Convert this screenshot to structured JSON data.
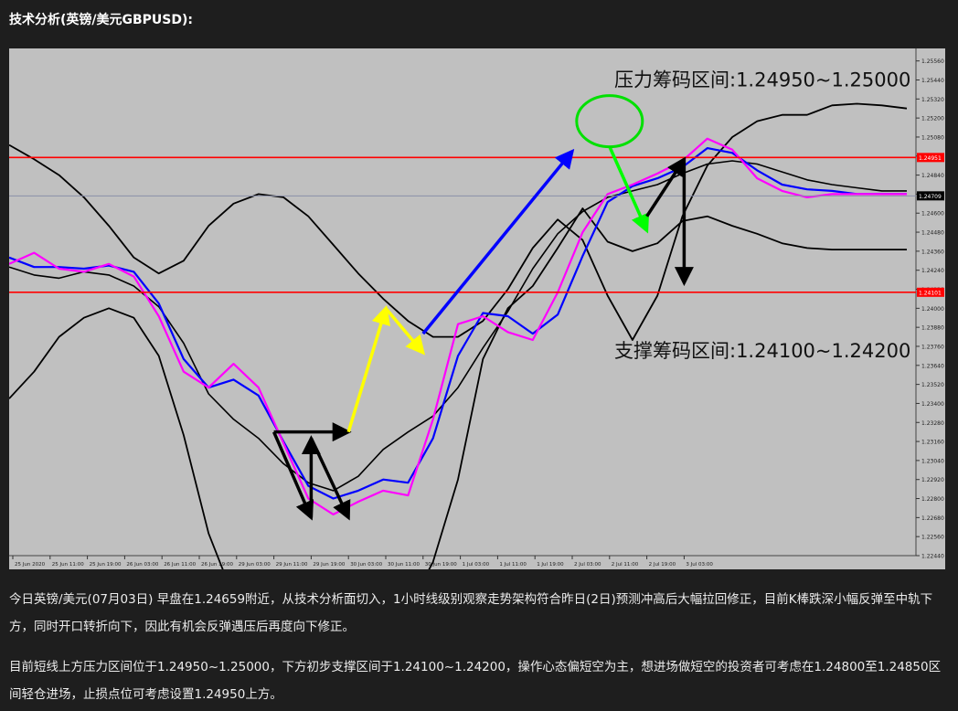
{
  "page": {
    "heading": "技术分析(英镑/美元GBPUSD):",
    "paragraphs": [
      "今日英镑/美元(07月03日) 早盘在1.24659附近，从技术分析面切入，1小时线级别观察走势架构符合昨日(2日)预测冲高后大幅拉回修正，目前K棒跌深小幅反弹至中轨下方，同时开口转折向下，因此有机会反弹遇压后再度向下修正。",
      "目前短线上方压力区间位于1.24950~1.25000，下方初步支撑区间于1.24100~1.24200，操作心态偏短空为主，想进场做短空的投资者可考虑在1.24800至1.24850区间轻仓进场，止损点位可考虑设置1.24950上方。"
    ]
  },
  "chart_data": {
    "type": "line",
    "title": "",
    "instrument": "GBPUSD",
    "timeframe": "H1",
    "x_tick_labels": [
      "25 Jun 2020",
      "25 Jun 11:00",
      "25 Jun 19:00",
      "26 Jun 03:00",
      "26 Jun 11:00",
      "26 Jun 19:00",
      "29 Jun 03:00",
      "29 Jun 11:00",
      "29 Jun 19:00",
      "30 Jun 03:00",
      "30 Jun 11:00",
      "30 Jun 19:00",
      "1 Jul 03:00",
      "1 Jul 11:00",
      "1 Jul 19:00",
      "2 Jul 03:00",
      "2 Jul 11:00",
      "2 Jul 19:00",
      "3 Jul 03:00"
    ],
    "y_tick_labels": [
      "1.25560",
      "1.25440",
      "1.25320",
      "1.25200",
      "1.25080",
      "1.24960",
      "1.24840",
      "1.24720",
      "1.24600",
      "1.24480",
      "1.24360",
      "1.24240",
      "1.24120",
      "1.24000",
      "1.23880",
      "1.23760",
      "1.23640",
      "1.23520",
      "1.23400",
      "1.23280",
      "1.23160",
      "1.23040",
      "1.22920",
      "1.22800",
      "1.22680",
      "1.22560",
      "1.22440"
    ],
    "ylim": [
      1.2244,
      1.2561
    ],
    "grid": false,
    "horizontal_lines": [
      {
        "value": 1.24951,
        "label": "1.24951",
        "color": "#ff0000"
      },
      {
        "value": 1.24101,
        "label": "1.24101",
        "color": "#ff0000"
      },
      {
        "value": 1.24709,
        "label": "1.24709",
        "color": "#8a8fa8"
      }
    ],
    "annotations": [
      {
        "text": "压力筹码区间:1.24950~1.25000",
        "x": "2 Jul 03:00",
        "y": 1.254
      },
      {
        "text": "支撑筹码区间:1.24100~1.24200",
        "x": "2 Jul 03:00",
        "y": 1.2369
      }
    ],
    "series": [
      {
        "color": "#000000",
        "values": [
          1.2503,
          1.2494,
          1.2484,
          1.247,
          1.2452,
          1.2432,
          1.2422,
          1.243,
          1.2452,
          1.2466,
          1.2472,
          1.247,
          1.2458,
          1.244,
          1.2422,
          1.2406,
          1.2392,
          1.2382,
          1.2382,
          1.2392,
          1.2412,
          1.2438,
          1.2456,
          1.2443,
          1.2408,
          1.238,
          1.2408,
          1.2458,
          1.249,
          1.2508,
          1.2518,
          1.2522,
          1.2522,
          1.2528,
          1.2529,
          1.2528,
          1.2526
        ]
      },
      {
        "color": "#000000",
        "values": [
          1.2426,
          1.2421,
          1.2419,
          1.2423,
          1.2421,
          1.2414,
          1.2401,
          1.2378,
          1.2346,
          1.233,
          1.2318,
          1.2302,
          1.229,
          1.2285,
          1.2294,
          1.2311,
          1.2322,
          1.2332,
          1.235,
          1.2375,
          1.2398,
          1.2425,
          1.2447,
          1.2461,
          1.247,
          1.2474,
          1.2478,
          1.2485,
          1.2491,
          1.2493,
          1.2491,
          1.2486,
          1.2481,
          1.2478,
          1.2476,
          1.2474,
          1.2474
        ]
      },
      {
        "color": "#000000",
        "values": [
          1.2343,
          1.236,
          1.2382,
          1.2394,
          1.24,
          1.2394,
          1.237,
          1.232,
          1.2258,
          1.2218,
          1.22,
          1.2185,
          1.2167,
          1.2163,
          1.2173,
          1.219,
          1.221,
          1.224,
          1.2292,
          1.2368,
          1.24,
          1.2414,
          1.2438,
          1.2463,
          1.2442,
          1.2436,
          1.2441,
          1.2455,
          1.2458,
          1.2452,
          1.2447,
          1.2441,
          1.2438,
          1.2437,
          1.2437,
          1.2437,
          1.2437
        ]
      },
      {
        "color": "#0000ff",
        "values": [
          1.2432,
          1.2426,
          1.2426,
          1.2425,
          1.2427,
          1.2423,
          1.2403,
          1.2368,
          1.235,
          1.2355,
          1.2345,
          1.2316,
          1.2288,
          1.228,
          1.2285,
          1.2292,
          1.229,
          1.2318,
          1.237,
          1.2397,
          1.2395,
          1.2384,
          1.2396,
          1.2433,
          1.2467,
          1.2477,
          1.2482,
          1.2489,
          1.2501,
          1.2498,
          1.2487,
          1.2478,
          1.2475,
          1.2474,
          1.2472,
          1.2472,
          1.2472
        ]
      },
      {
        "color": "#ff00ff",
        "values": [
          1.2428,
          1.2435,
          1.2425,
          1.2423,
          1.2428,
          1.242,
          1.2395,
          1.236,
          1.235,
          1.2365,
          1.235,
          1.2315,
          1.228,
          1.227,
          1.2278,
          1.2285,
          1.2282,
          1.233,
          1.239,
          1.2395,
          1.2385,
          1.238,
          1.241,
          1.2448,
          1.2472,
          1.2478,
          1.2485,
          1.2493,
          1.2507,
          1.25,
          1.2482,
          1.2474,
          1.247,
          1.2472,
          1.2472,
          1.2472,
          1.2472
        ]
      }
    ],
    "arrows": [
      {
        "color": "#000000",
        "from": [
          "29 Jun 11:00",
          1.2322
        ],
        "to": [
          "30 Jun 03:00",
          1.2322
        ]
      },
      {
        "color": "#000000",
        "from": [
          "29 Jun 11:00",
          1.2322
        ],
        "to": [
          "29 Jun 19:00",
          1.2268
        ]
      },
      {
        "color": "#000000",
        "from": [
          "29 Jun 19:00",
          1.2268
        ],
        "to": [
          "29 Jun 19:00",
          1.2318
        ]
      },
      {
        "color": "#000000",
        "from": [
          "29 Jun 19:00",
          1.2318
        ],
        "to": [
          "30 Jun 03:00",
          1.2268
        ]
      },
      {
        "color": "#ffff00",
        "from": [
          "30 Jun 03:00",
          1.2322
        ],
        "to": [
          "30 Jun 11:00",
          1.24
        ]
      },
      {
        "color": "#ffff00",
        "from": [
          "30 Jun 11:00",
          1.24
        ],
        "to": [
          "30 Jun 19:00",
          1.2372
        ]
      },
      {
        "color": "#0000ff",
        "from": [
          "30 Jun 19:00",
          1.2384
        ],
        "to": [
          "2 Jul 03:00",
          1.2499
        ]
      },
      {
        "color": "#00ff00",
        "from": [
          "2 Jul 11:00",
          1.2502
        ],
        "to": [
          "2 Jul 19:00",
          1.2449
        ]
      },
      {
        "color": "#000000",
        "from": [
          "2 Jul 19:00",
          1.2458
        ],
        "to": [
          "3 Jul 03:00",
          1.2494
        ]
      },
      {
        "color": "#000000",
        "from": [
          "3 Jul 03:00",
          1.2494
        ],
        "to": [
          "3 Jul 03:00",
          1.2416
        ]
      }
    ],
    "highlight_circle": {
      "color": "#00e000",
      "x": "2 Jul 11:00",
      "y": 1.2518
    }
  }
}
